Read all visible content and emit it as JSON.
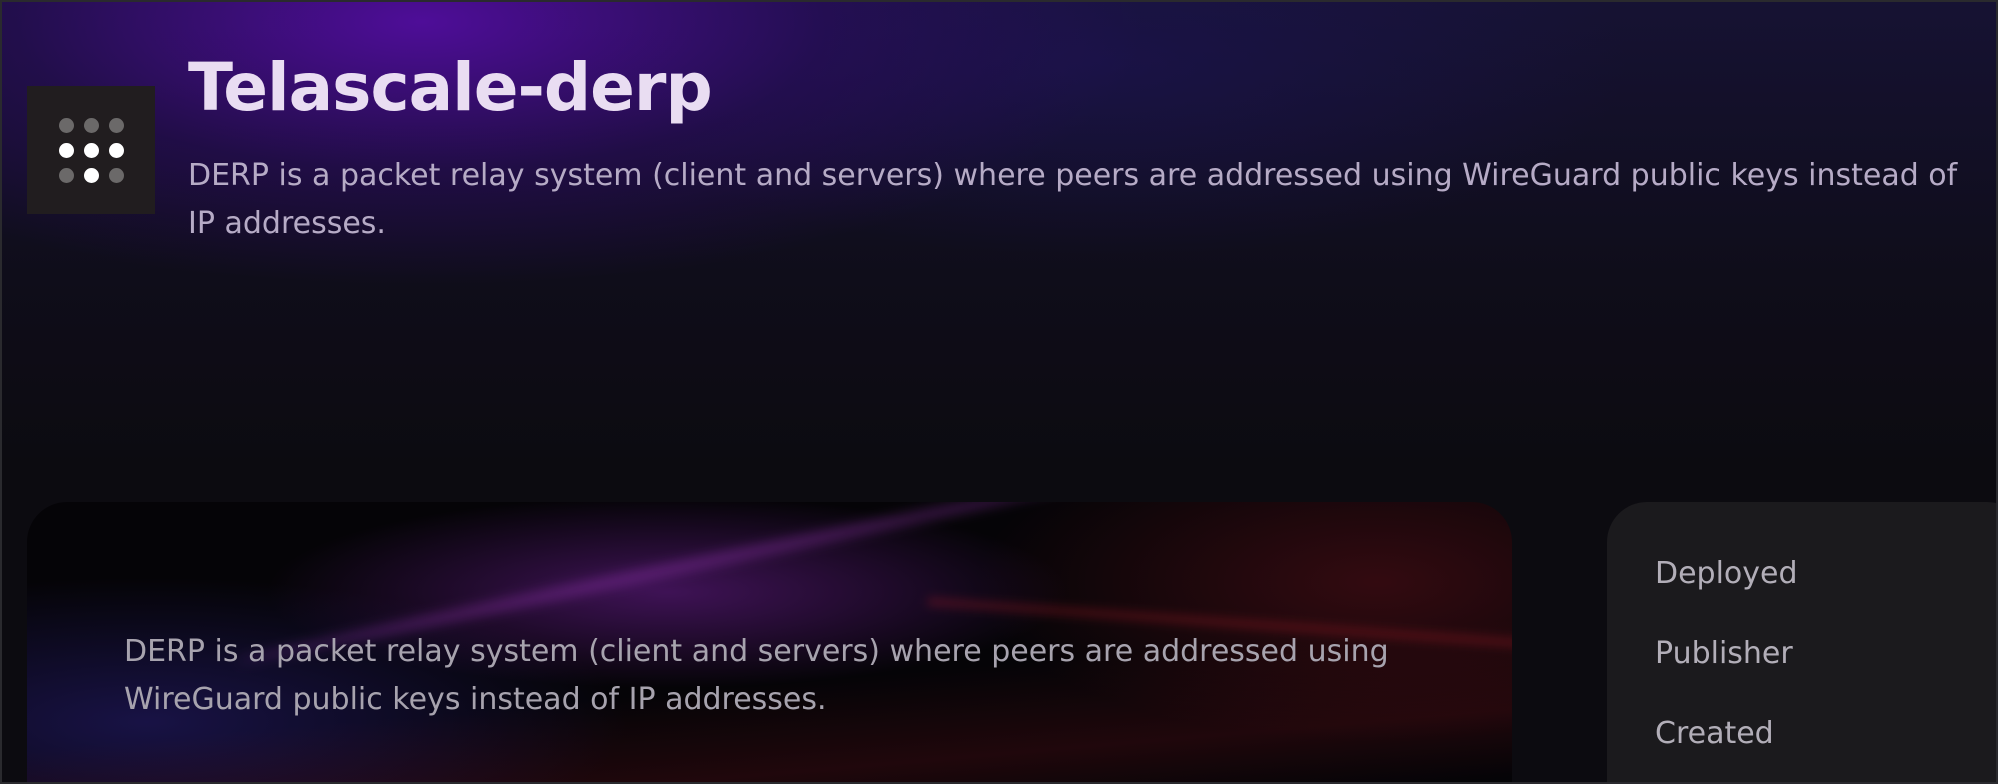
{
  "header": {
    "icon": "dot-grid-icon",
    "title": "Telascale-derp",
    "description": "DERP is a packet relay system (client and servers) where peers are addressed using WireGuard public keys instead of IP addresses."
  },
  "readme": {
    "text": "DERP is a packet relay system (client and servers) where peers are addressed using WireGuard public keys instead of IP addresses."
  },
  "details": {
    "labels": [
      "Deployed",
      "Publisher",
      "Created"
    ]
  },
  "colors": {
    "accent_purple": "#580caa",
    "title": "#e9ddf2",
    "background": "#0c0b10"
  }
}
